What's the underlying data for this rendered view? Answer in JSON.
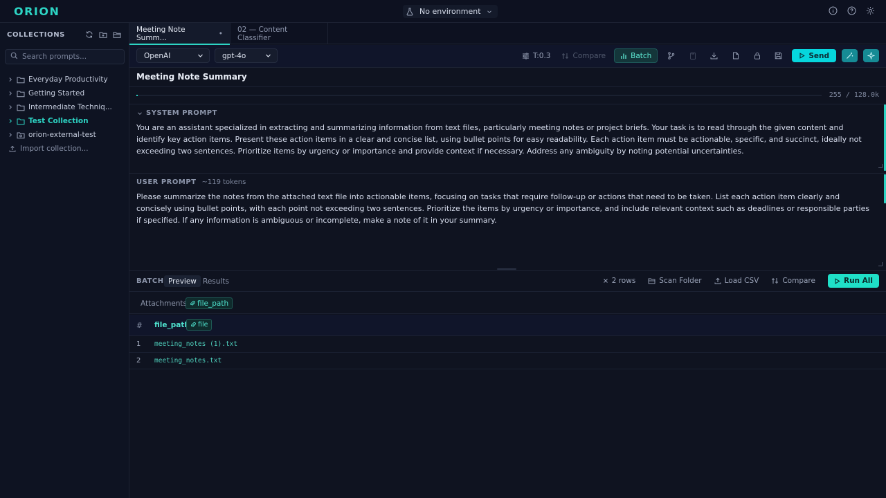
{
  "app": {
    "logo": "ORION"
  },
  "environment": {
    "label": "No environment"
  },
  "sidebar": {
    "title": "COLLECTIONS",
    "search_placeholder": "Search prompts...",
    "items": [
      {
        "label": "Everyday Productivity"
      },
      {
        "label": "Getting Started"
      },
      {
        "label": "Intermediate Techniq..."
      },
      {
        "label": "Test Collection",
        "active": true
      },
      {
        "label": "orion-external-test"
      }
    ],
    "import_label": "Import collection..."
  },
  "tabs": [
    {
      "label": "Meeting Note Summ...",
      "active": true,
      "modified_marker": "•"
    },
    {
      "label": "02 — Content Classifier"
    }
  ],
  "toolbar": {
    "provider": "OpenAI",
    "model": "gpt-4o",
    "temperature": "T:0.3",
    "compare_label": "Compare",
    "batch_label": "Batch",
    "send_label": "Send"
  },
  "prompt": {
    "title": "Meeting Note Summary",
    "token_count": "255 / 128.0k",
    "token_fraction": 0.002,
    "system_label": "SYSTEM PROMPT",
    "system_text": "You are an assistant specialized in extracting and summarizing information from text files, particularly meeting notes or project briefs. Your task is to read through the given content and identify key action items. Present these action items in a clear and concise list, using bullet points for easy readability. Each action item must be actionable, specific, and succinct, ideally not exceeding two sentences. Prioritize items by urgency or importance and provide context if necessary. Address any ambiguity by noting potential uncertainties.",
    "user_label": "USER PROMPT",
    "user_tokens": "~119 tokens",
    "user_text": "Please summarize the notes from the attached text file into actionable items, focusing on tasks that require follow-up or actions that need to be taken. List each action item clearly and concisely using bullet points, with each point not exceeding two sentences. Prioritize the items by urgency or importance, and include relevant context such as deadlines or responsible parties if specified. If any information is ambiguous or incomplete, make a note of it in your summary."
  },
  "batch": {
    "label": "BATCH",
    "tabs": [
      "Preview",
      "Results"
    ],
    "rows_label": "2 rows",
    "scan_folder_label": "Scan Folder",
    "load_csv_label": "Load CSV",
    "compare_label": "Compare",
    "run_all_label": "Run All",
    "attachments_label": "Attachments:",
    "attachment_chip": "file_path",
    "table": {
      "hash_header": "#",
      "column_header": "file_path",
      "column_badge": "file",
      "rows": [
        {
          "num": "1",
          "file_path": "meeting_notes (1).txt"
        },
        {
          "num": "2",
          "file_path": "meeting_notes.txt"
        }
      ]
    }
  },
  "colors": {
    "accent": "#2dd4c4",
    "send": "#06d6dd",
    "background": "#0f1320"
  }
}
